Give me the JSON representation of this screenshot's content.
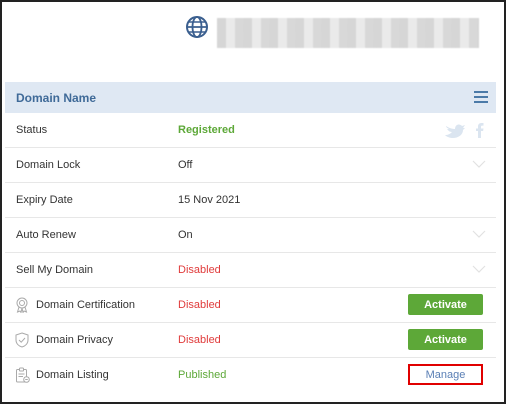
{
  "header": {
    "title": "Domain Name"
  },
  "rows": [
    {
      "label": "Status",
      "value": "Registered"
    },
    {
      "label": "Domain Lock",
      "value": "Off"
    },
    {
      "label": "Expiry Date",
      "value": "15 Nov 2021"
    },
    {
      "label": "Auto Renew",
      "value": "On"
    },
    {
      "label": "Sell My Domain",
      "value": "Disabled"
    },
    {
      "label": "Domain Certification",
      "value": "Disabled",
      "action": "Activate"
    },
    {
      "label": "Domain Privacy",
      "value": "Disabled",
      "action": "Activate"
    },
    {
      "label": "Domain Listing",
      "value": "Published",
      "action": "Manage"
    }
  ],
  "icons": {
    "globe": "globe-icon",
    "menu": "hamburger-menu-icon",
    "twitter": "twitter-icon",
    "facebook": "facebook-icon",
    "certification": "ribbon-badge-icon",
    "privacy": "shield-check-icon",
    "listing": "clipboard-list-icon"
  },
  "colors": {
    "header_bg": "#dfe8f3",
    "header_text": "#3f6a98",
    "green": "#5da838",
    "red": "#e03b3b",
    "highlight_border": "#e00000"
  }
}
